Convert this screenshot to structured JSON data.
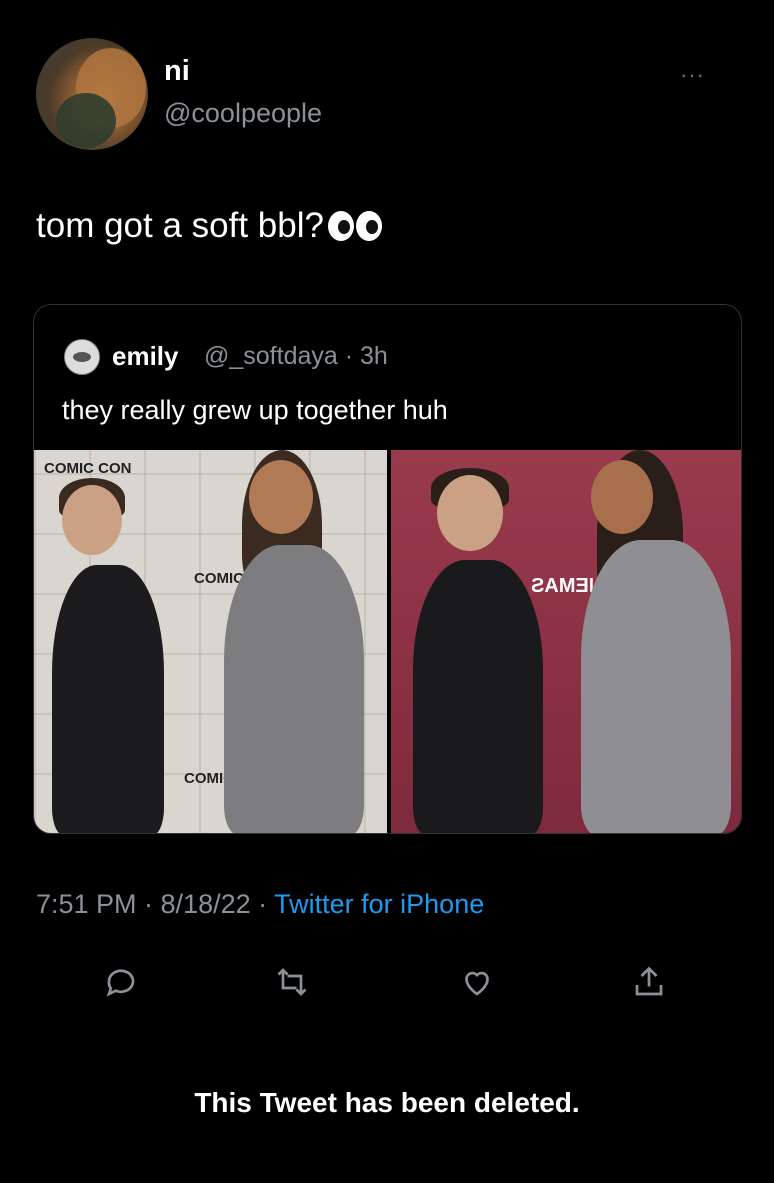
{
  "author": {
    "name": "ni",
    "handle": "@coolpeople"
  },
  "more_label": "···",
  "tweet": {
    "text": "tom got a soft bbl?",
    "emoji": "eyes-icon"
  },
  "quoted": {
    "name": "emily",
    "meta": "@_softdaya · 3h",
    "text": "they really grew up together huh",
    "photo_left_sign": "COMIC CON",
    "photo_right_sign": "ONLY AT CINEMAS"
  },
  "timestamp": {
    "time": "7:51 PM · 8/18/22 · ",
    "source": "Twitter for iPhone"
  },
  "actions": [
    "reply-icon",
    "retweet-icon",
    "like-icon",
    "share-icon"
  ],
  "notice": "This Tweet has been deleted."
}
